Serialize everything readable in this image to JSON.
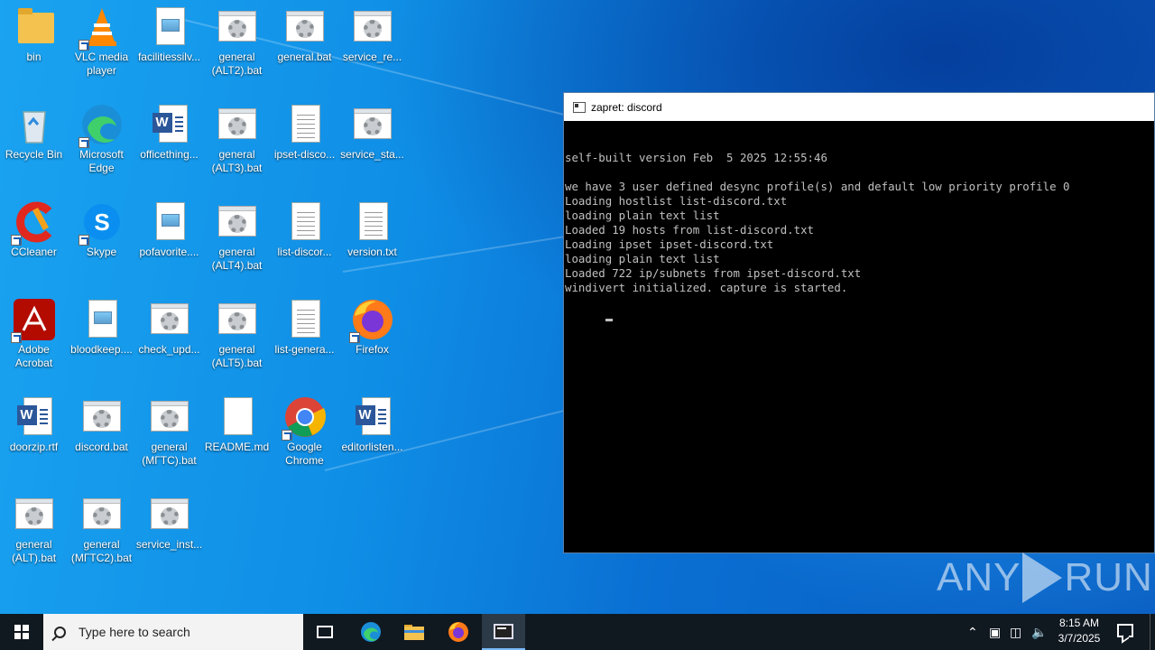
{
  "desktop": {
    "icons": [
      {
        "label": "bin",
        "type": "folder"
      },
      {
        "label": "VLC media\nplayer",
        "type": "vlc"
      },
      {
        "label": "facilitiessilv...",
        "type": "image"
      },
      {
        "label": "general\n(ALT2).bat",
        "type": "bat"
      },
      {
        "label": "general.bat",
        "type": "bat"
      },
      {
        "label": "service_re...",
        "type": "bat"
      },
      {
        "label": "Recycle Bin",
        "type": "recycle"
      },
      {
        "label": "Microsoft\nEdge",
        "type": "edge"
      },
      {
        "label": "officething...",
        "type": "word"
      },
      {
        "label": "general\n(ALT3).bat",
        "type": "bat"
      },
      {
        "label": "ipset-disco...",
        "type": "text"
      },
      {
        "label": "service_sta...",
        "type": "bat"
      },
      {
        "label": "CCleaner",
        "type": "ccleaner"
      },
      {
        "label": "Skype",
        "type": "skype"
      },
      {
        "label": "pofavorite....",
        "type": "image"
      },
      {
        "label": "general\n(ALT4).bat",
        "type": "bat"
      },
      {
        "label": "list-discor...",
        "type": "text"
      },
      {
        "label": "version.txt",
        "type": "text"
      },
      {
        "label": "Adobe\nAcrobat",
        "type": "acrobat"
      },
      {
        "label": "bloodkeep....",
        "type": "image"
      },
      {
        "label": "check_upd...",
        "type": "bat"
      },
      {
        "label": "general\n(ALT5).bat",
        "type": "bat"
      },
      {
        "label": "list-genera...",
        "type": "text"
      },
      {
        "label": "Firefox",
        "type": "firefox"
      },
      {
        "label": "doorzip.rtf",
        "type": "word"
      },
      {
        "label": "discord.bat",
        "type": "bat"
      },
      {
        "label": "general\n(МГТС).bat",
        "type": "bat"
      },
      {
        "label": "README.md",
        "type": "blank"
      },
      {
        "label": "Google\nChrome",
        "type": "chrome"
      },
      {
        "label": "editorlisten...",
        "type": "word"
      },
      {
        "label": "general\n(ALT).bat",
        "type": "bat"
      },
      {
        "label": "general\n(МГТС2).bat",
        "type": "bat"
      },
      {
        "label": "service_inst...",
        "type": "bat"
      }
    ]
  },
  "console": {
    "title": "zapret: discord",
    "lines": [
      "self-built version Feb  5 2025 12:55:46",
      "",
      "we have 3 user defined desync profile(s) and default low priority profile 0",
      "Loading hostlist list-discord.txt",
      "loading plain text list",
      "Loaded 19 hosts from list-discord.txt",
      "Loading ipset ipset-discord.txt",
      "loading plain text list",
      "Loaded 722 ip/subnets from ipset-discord.txt",
      "windivert initialized. capture is started."
    ]
  },
  "watermark": {
    "left": "ANY",
    "right": "RUN"
  },
  "taskbar": {
    "search_placeholder": "Type here to search",
    "clock_time": "8:15 AM",
    "clock_date": "3/7/2025"
  }
}
